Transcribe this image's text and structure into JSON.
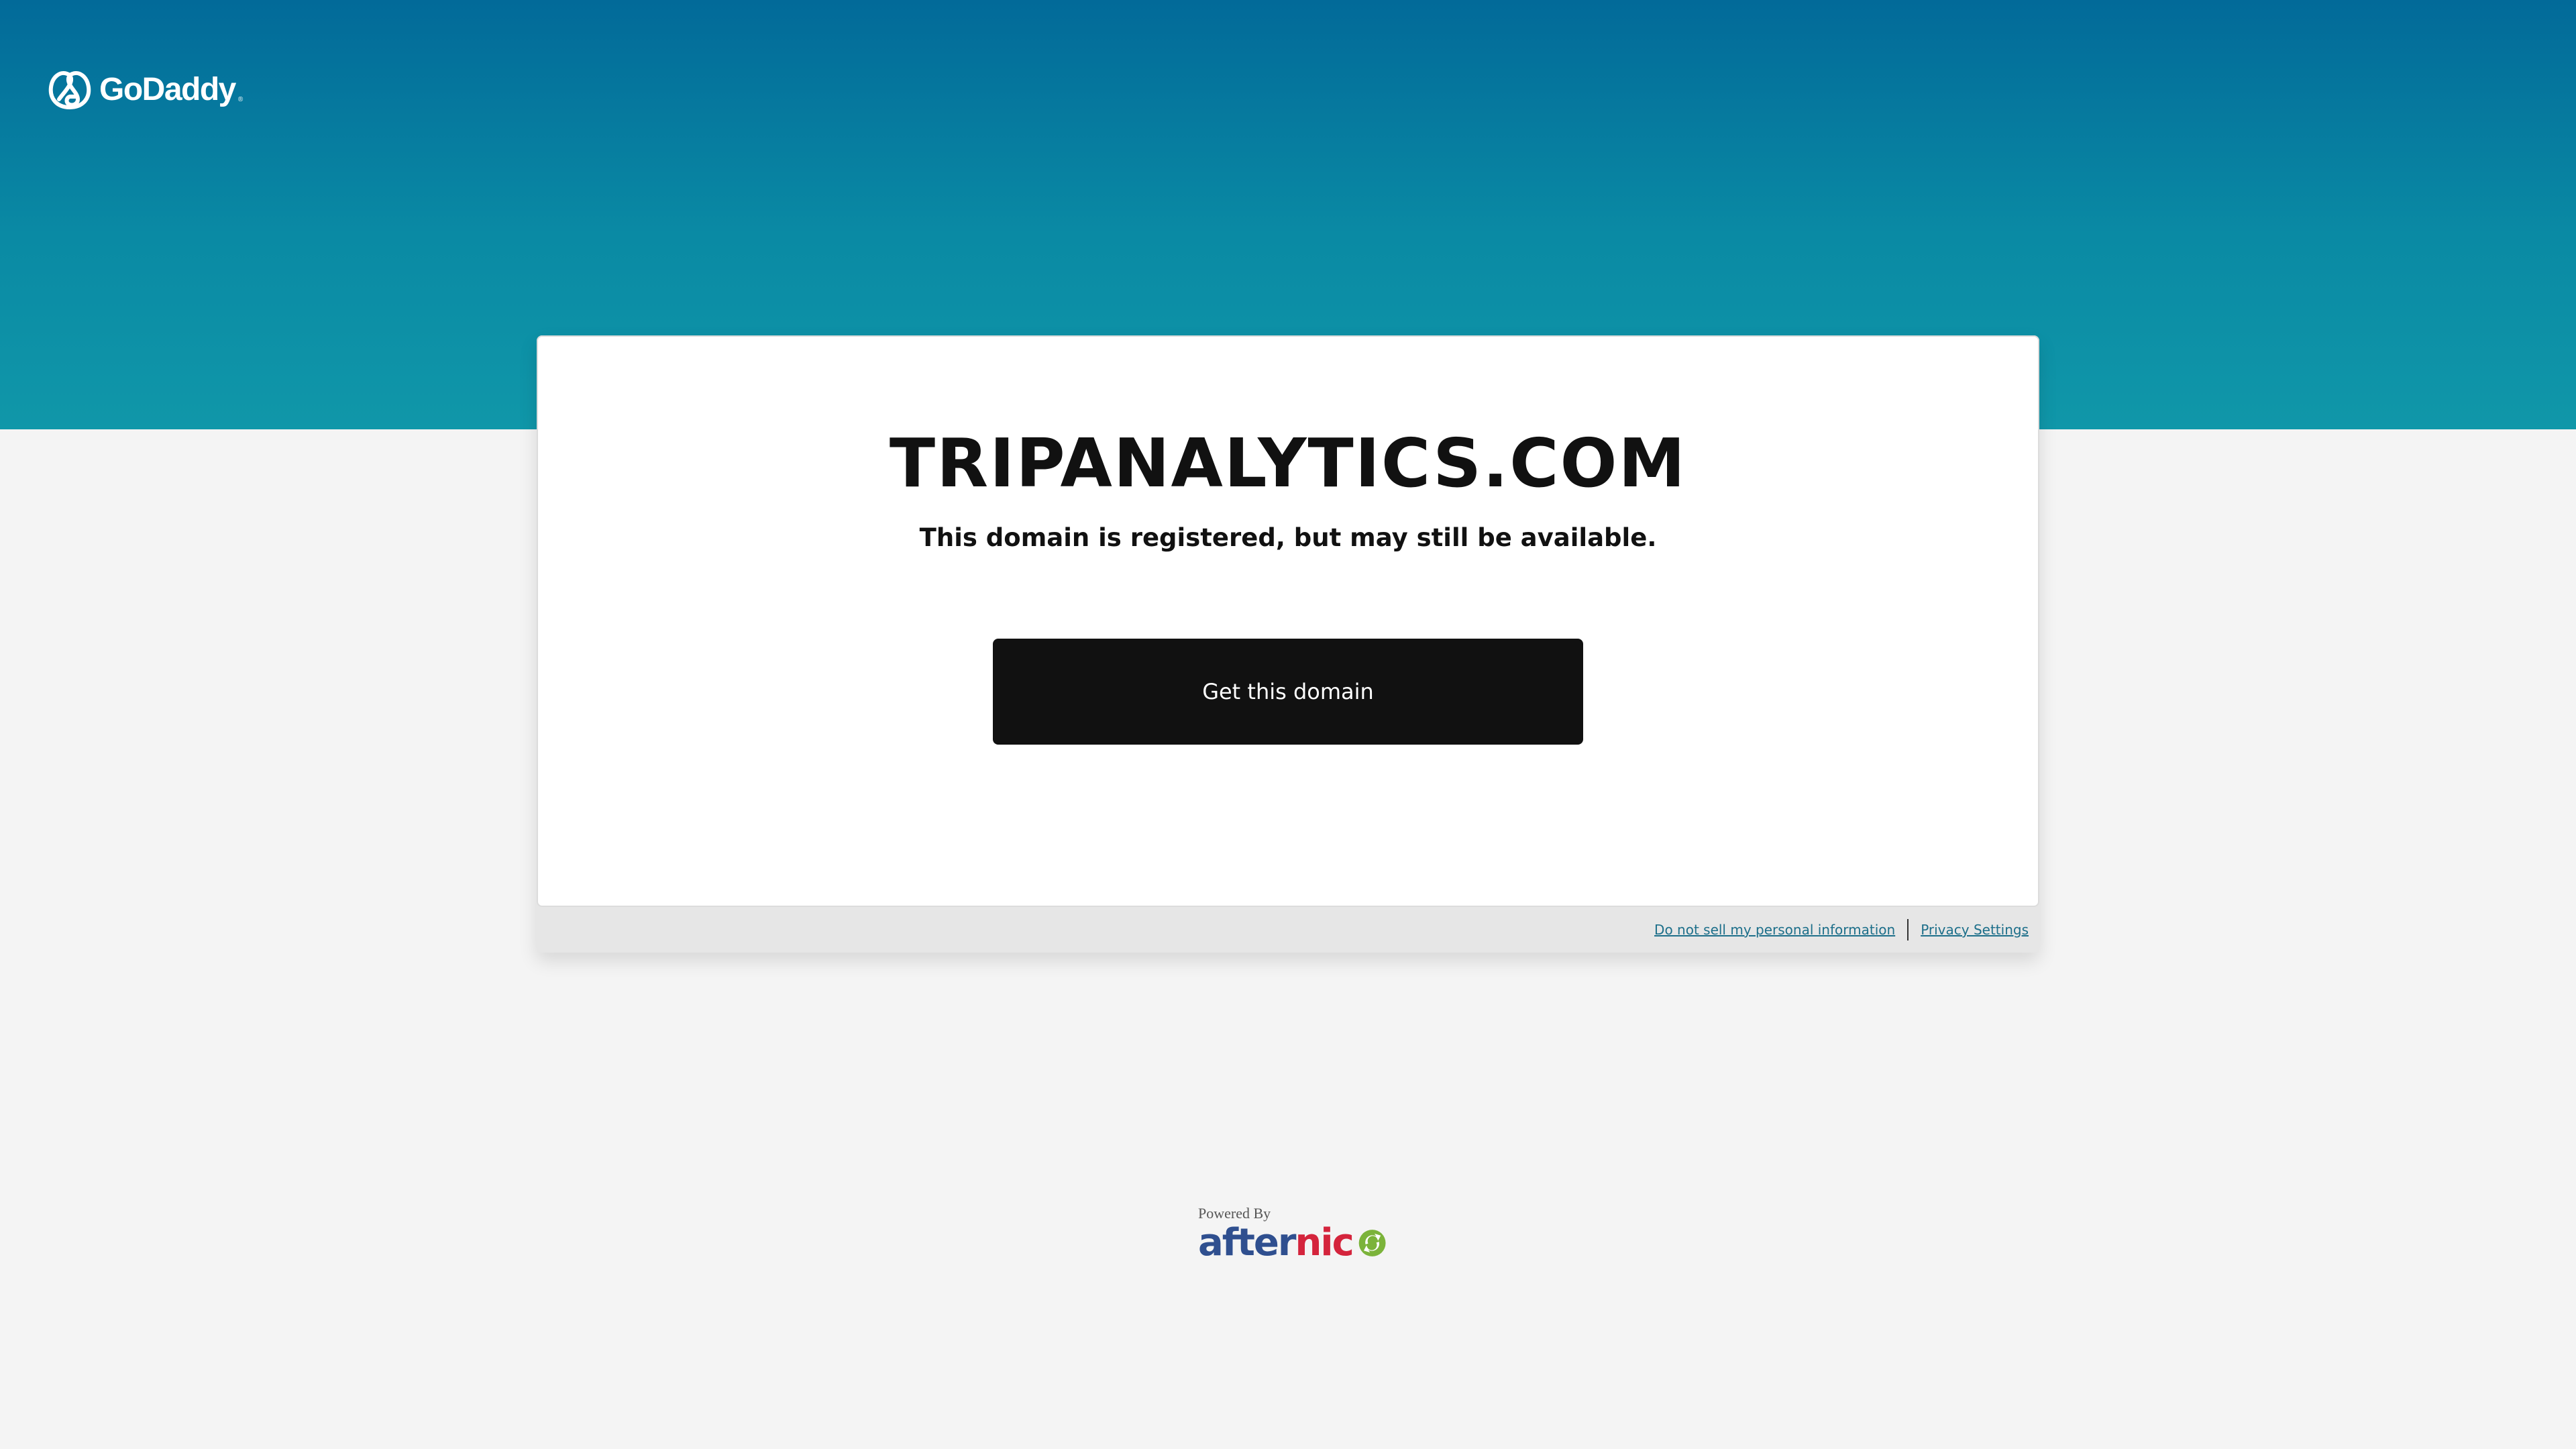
{
  "header": {
    "logo_text": "GoDaddy",
    "logo_tm": "®",
    "logo_icon": "godaddy-logo-icon"
  },
  "card": {
    "domain": "TRIPANALYTICS.COM",
    "subtitle": "This domain is registered, but may still be available.",
    "cta_label": "Get this domain"
  },
  "footer": {
    "do_not_sell": "Do not sell my personal information",
    "privacy_settings": "Privacy Settings"
  },
  "powered": {
    "label": "Powered By",
    "brand_after": "after",
    "brand_nic": "nic",
    "brand_icon": "afternic-icon"
  },
  "colors": {
    "hero_top": "#026a99",
    "hero_bottom": "#1097a9",
    "button_bg": "#111111",
    "link": "#1d6f8a",
    "afternic_blue": "#2f4f8f",
    "afternic_red": "#d4243c",
    "afternic_green": "#7bb33a"
  }
}
